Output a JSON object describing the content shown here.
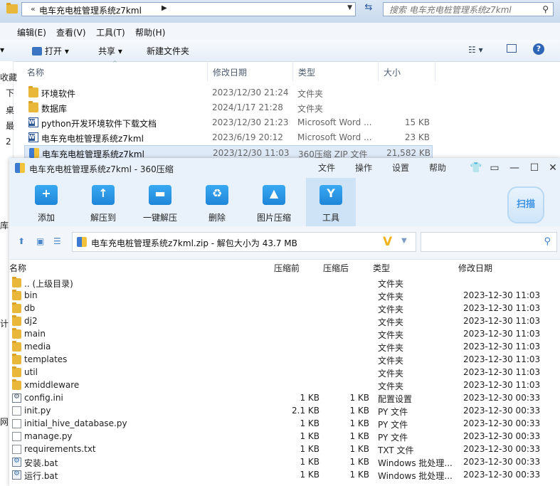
{
  "explorer": {
    "address_path": "电车充电桩管理系统z7kml",
    "search_placeholder": "搜索 电车充电桩管理系统z7kml",
    "menu": [
      "编辑(E)",
      "查看(V)",
      "工具(T)",
      "帮助(H)"
    ],
    "toolbar": {
      "open": "打开",
      "share": "共享",
      "new_folder": "新建文件夹"
    },
    "columns": {
      "name": "名称",
      "date": "修改日期",
      "type": "类型",
      "size": "大小"
    },
    "sidebar_fragments": [
      "收藏",
      "下",
      "桌",
      "最",
      "2",
      "库",
      "计",
      "网"
    ],
    "files": [
      {
        "name": "环境软件",
        "date": "2023/12/30 21:24",
        "type": "文件夹",
        "size": "",
        "icon": "folder-icon"
      },
      {
        "name": "数据库",
        "date": "2024/1/17 21:28",
        "type": "文件夹",
        "size": "",
        "icon": "folder-icon"
      },
      {
        "name": "python开发环境软件下载文档",
        "date": "2023/12/30 21:23",
        "type": "Microsoft Word ...",
        "size": "15 KB",
        "icon": "word-icon"
      },
      {
        "name": "电车充电桩管理系统z7kml",
        "date": "2023/6/19 20:12",
        "type": "Microsoft Word ...",
        "size": "23 KB",
        "icon": "word-icon"
      },
      {
        "name": "电车充电桩管理系统z7kml",
        "date": "2023/12/30 11:03",
        "type": "360压缩 ZIP 文件",
        "size": "21,582 KB",
        "icon": "zip-icon"
      }
    ]
  },
  "zip": {
    "title": "电车充电桩管理系统z7kml - 360压缩",
    "menu": [
      "文件",
      "操作",
      "设置",
      "帮助"
    ],
    "tools": [
      "添加",
      "解压到",
      "一键解压",
      "删除",
      "图片压缩",
      "工具"
    ],
    "scan_label": "扫描",
    "path_text": "电车充电桩管理系统z7kml.zip - 解包大小为 43.7 MB",
    "columns": {
      "name": "名称",
      "compressed": "压缩前",
      "packed": "压缩后",
      "type": "类型",
      "date": "修改日期"
    },
    "rows": [
      {
        "name": ".. (上级目录)",
        "before": "",
        "after": "",
        "type": "文件夹",
        "date": "",
        "icon": "folder-icon"
      },
      {
        "name": "bin",
        "before": "",
        "after": "",
        "type": "文件夹",
        "date": "2023-12-30 11:03",
        "icon": "folder-icon"
      },
      {
        "name": "db",
        "before": "",
        "after": "",
        "type": "文件夹",
        "date": "2023-12-30 11:03",
        "icon": "folder-icon"
      },
      {
        "name": "dj2",
        "before": "",
        "after": "",
        "type": "文件夹",
        "date": "2023-12-30 11:03",
        "icon": "folder-icon"
      },
      {
        "name": "main",
        "before": "",
        "after": "",
        "type": "文件夹",
        "date": "2023-12-30 11:03",
        "icon": "folder-icon"
      },
      {
        "name": "media",
        "before": "",
        "after": "",
        "type": "文件夹",
        "date": "2023-12-30 11:03",
        "icon": "folder-icon"
      },
      {
        "name": "templates",
        "before": "",
        "after": "",
        "type": "文件夹",
        "date": "2023-12-30 11:03",
        "icon": "folder-icon"
      },
      {
        "name": "util",
        "before": "",
        "after": "",
        "type": "文件夹",
        "date": "2023-12-30 11:03",
        "icon": "folder-icon"
      },
      {
        "name": "xmiddleware",
        "before": "",
        "after": "",
        "type": "文件夹",
        "date": "2023-12-30 11:03",
        "icon": "folder-icon"
      },
      {
        "name": "config.ini",
        "before": "1 KB",
        "after": "1 KB",
        "type": "配置设置",
        "date": "2023-12-30 00:33",
        "icon": "ini-icon"
      },
      {
        "name": "init.py",
        "before": "2.1 KB",
        "after": "1 KB",
        "type": "PY 文件",
        "date": "2023-12-30 00:33",
        "icon": "file-icon"
      },
      {
        "name": "initial_hive_database.py",
        "before": "1 KB",
        "after": "1 KB",
        "type": "PY 文件",
        "date": "2023-12-30 00:33",
        "icon": "file-icon"
      },
      {
        "name": "manage.py",
        "before": "1 KB",
        "after": "1 KB",
        "type": "PY 文件",
        "date": "2023-12-30 00:33",
        "icon": "file-icon"
      },
      {
        "name": "requirements.txt",
        "before": "1 KB",
        "after": "1 KB",
        "type": "TXT 文件",
        "date": "2023-12-30 00:33",
        "icon": "file-icon"
      },
      {
        "name": "安装.bat",
        "before": "1 KB",
        "after": "1 KB",
        "type": "Windows 批处理...",
        "date": "2023-12-30 00:33",
        "icon": "bat-icon"
      },
      {
        "name": "运行.bat",
        "before": "1 KB",
        "after": "1 KB",
        "type": "Windows 批处理...",
        "date": "2023-12-30 00:33",
        "icon": "bat-icon"
      }
    ]
  },
  "colors": {
    "accent": "#1f86d8",
    "folder": "#e9b739",
    "selection": "#dfeaf8"
  }
}
